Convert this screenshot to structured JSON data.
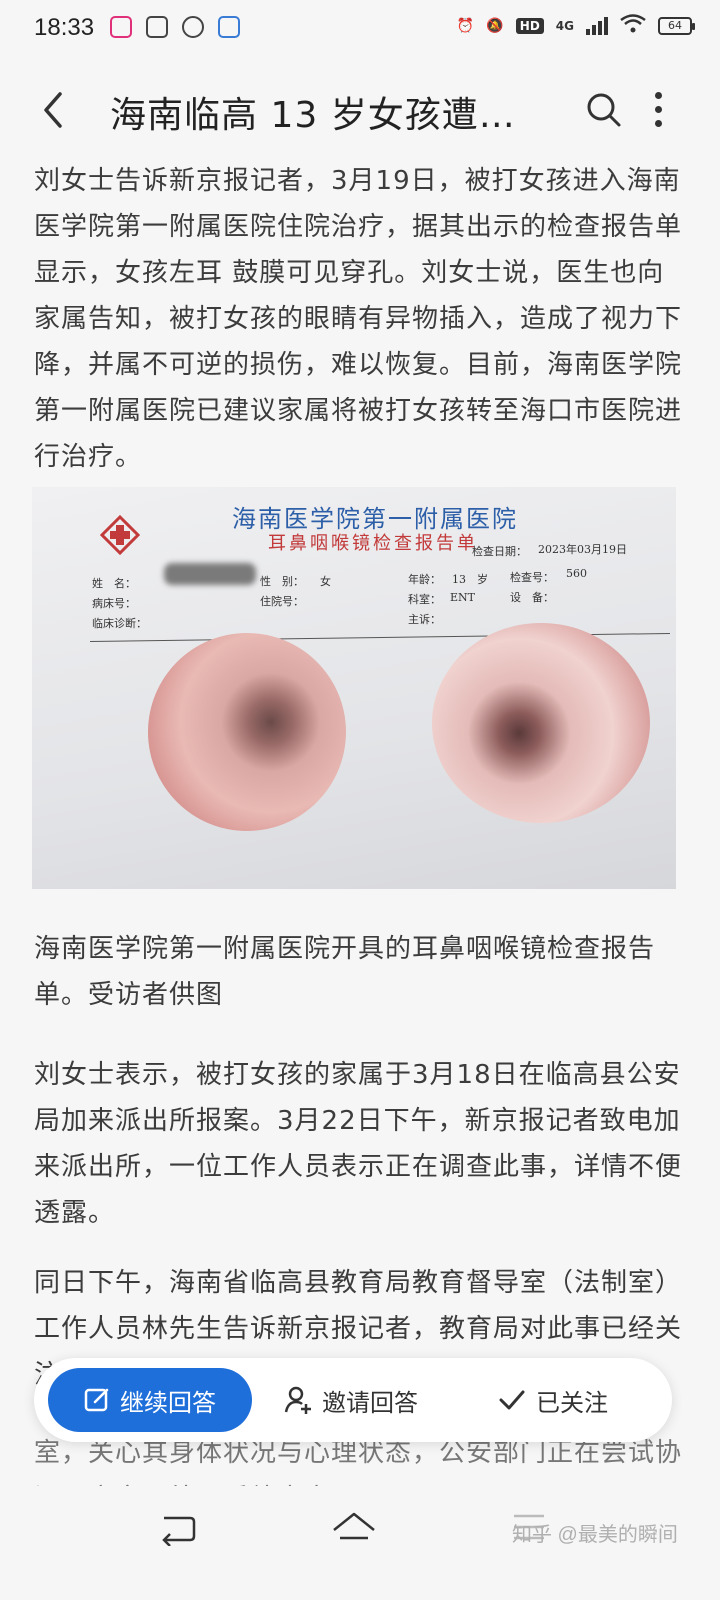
{
  "status_bar": {
    "time": "18:33",
    "network": "4G",
    "hd": "HD",
    "battery": "64"
  },
  "header": {
    "title": "海南临高 13 岁女孩遭…"
  },
  "article": {
    "paragraph1": "刘女士告诉新京报记者，3月19日，被打女孩进入海南医学院第一附属医院住院治疗，据其出示的检查报告单显示，女孩左耳 鼓膜可见穿孔。刘女士说，医生也向家属告知，被打女孩的眼睛有异物插入，造成了视力下降，并属不可逆的损伤，难以恢复。目前，海南医学院第一附属医院已建议家属将被打女孩转至海口市医院进行治疗。",
    "report_image": {
      "hospital": "海南医学院第一附属医院",
      "report_title": "耳鼻咽喉镜检查报告单",
      "date_label": "检查日期：",
      "date": "2023年03月19日",
      "name_label": "姓　名：",
      "sex_label": "性　别：",
      "sex": "女",
      "age_label": "年龄：",
      "age": "13　岁",
      "exam_no_label": "检查号：",
      "exam_no": "560",
      "bed_label": "病床号：",
      "admission_label": "住院号：",
      "dept_label": "科室：",
      "dept": "ENT",
      "device_label": "设　备：",
      "diagnosis_label": "临床诊断：",
      "complaint_label": "主诉："
    },
    "caption": "海南医学院第一附属医院开具的耳鼻咽喉镜检查报告单。受访者供图",
    "paragraph2": "刘女士表示，被打女孩的家属于3月18日在临高县公安局加来派出所报案。3月22日下午，新京报记者致电加来派出所，一位工作人员表示正在调查此事，详情不便透露。",
    "paragraph3": "同日下午，海南省临高县教育局教育督导室（法制室）工作人员林先生告诉新京报记者，教育局对此事已经关注并展开调查，已组织学校和临校",
    "paragraph3_tail": "室，关心其身体状况与心理状态，公安部门正在尝试协调双方家属处理后续事宜"
  },
  "action_bar": {
    "continue_label": "继续回答",
    "invite_label": "邀请回答",
    "follow_label": "已关注"
  },
  "watermark": "知乎 @最美的瞬间",
  "colors": {
    "accent": "#1f6fdb",
    "report_blue": "#2d5fa8",
    "report_red": "#c23a3a"
  }
}
